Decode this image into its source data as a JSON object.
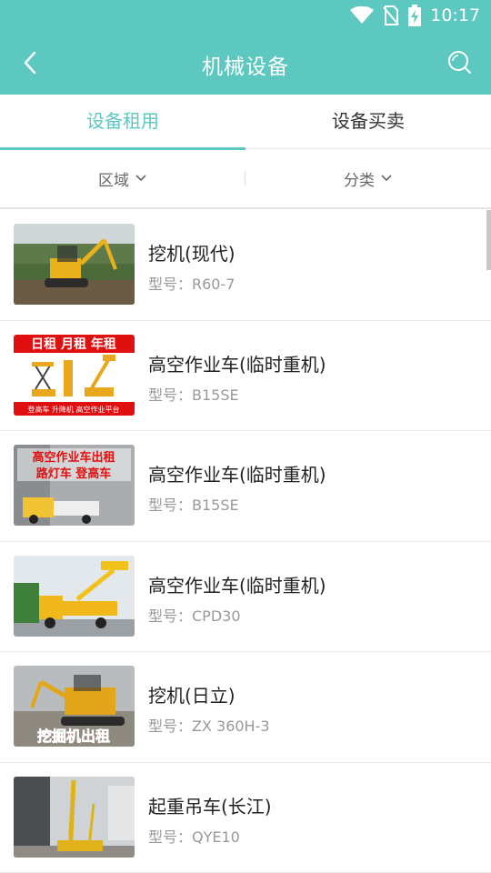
{
  "status": {
    "time": "10:17"
  },
  "header": {
    "title": "机械设备"
  },
  "tabs": [
    {
      "label": "设备租用",
      "active": true
    },
    {
      "label": "设备买卖",
      "active": false
    }
  ],
  "filters": [
    {
      "label": "区域"
    },
    {
      "label": "分类"
    }
  ],
  "items": [
    {
      "name": "挖机(现代)",
      "model": "型号：R60-7",
      "image": "excavator-photo"
    },
    {
      "name": "高空作业车(临时重机)",
      "model": "型号：B15SE",
      "image": "aerial-lift-ad",
      "banner": "日租 月租 年租",
      "caption": "登高车 升降机 高空作业平台"
    },
    {
      "name": "高空作业车(临时重机)",
      "model": "型号：B15SE",
      "image": "aerial-truck-ad",
      "banner1": "高空作业车出租",
      "banner2": "路灯车 登高车"
    },
    {
      "name": "高空作业车(临时重机)",
      "model": "型号：CPD30",
      "image": "aerial-truck-photo"
    },
    {
      "name": "挖机(日立)",
      "model": "型号：ZX 360H-3",
      "image": "excavator-ad",
      "banner": "挖掘机出租"
    },
    {
      "name": "起重吊车(长江)",
      "model": "型号：QYE10",
      "image": "crane-photo"
    }
  ],
  "colors": {
    "accent": "#5cc8bf"
  }
}
